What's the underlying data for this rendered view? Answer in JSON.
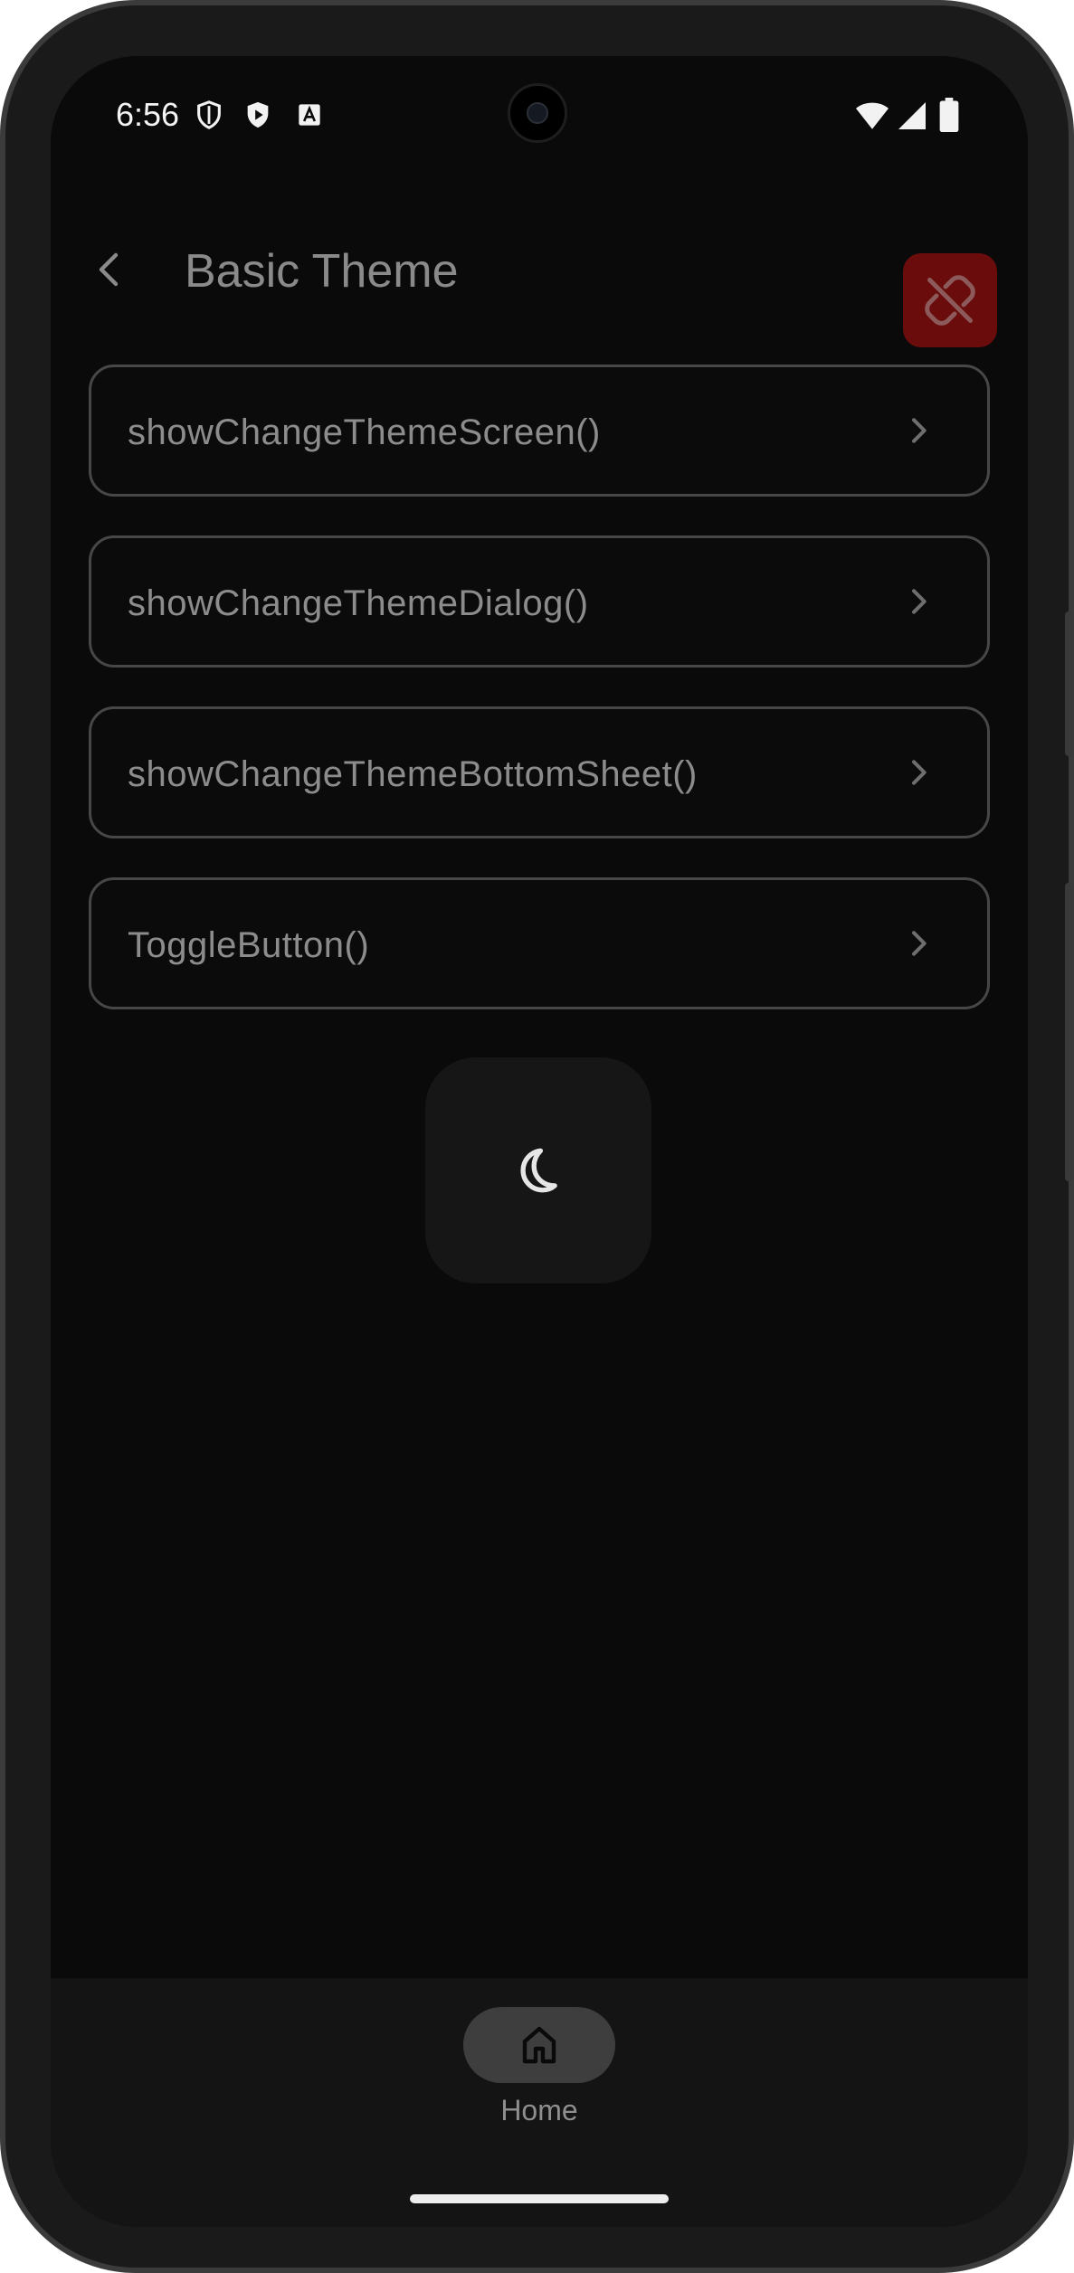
{
  "status_bar": {
    "time": "6:56",
    "left_icons": [
      "vpn-shield-icon",
      "play-protect-icon",
      "accessibility-a-icon"
    ],
    "right_icons": [
      "wifi-icon",
      "cellular-signal-icon",
      "battery-icon"
    ]
  },
  "app_bar": {
    "title": "Basic Theme",
    "back_icon": "arrow-back-icon",
    "action_icon": "link-off-icon",
    "action_color": "#6a0c0c"
  },
  "list": {
    "items": [
      {
        "label": "showChangeThemeScreen()"
      },
      {
        "label": "showChangeThemeDialog()"
      },
      {
        "label": "showChangeThemeBottomSheet()"
      },
      {
        "label": "ToggleButton()"
      }
    ]
  },
  "toggle": {
    "icon": "moon-icon"
  },
  "bottom_nav": {
    "items": [
      {
        "label": "Home",
        "icon": "home-icon",
        "selected": true
      }
    ]
  },
  "colors": {
    "background": "#0a0a0a",
    "card_border": "#474747",
    "text_muted": "#8c8c8c",
    "accent_red": "#6a0c0c"
  }
}
